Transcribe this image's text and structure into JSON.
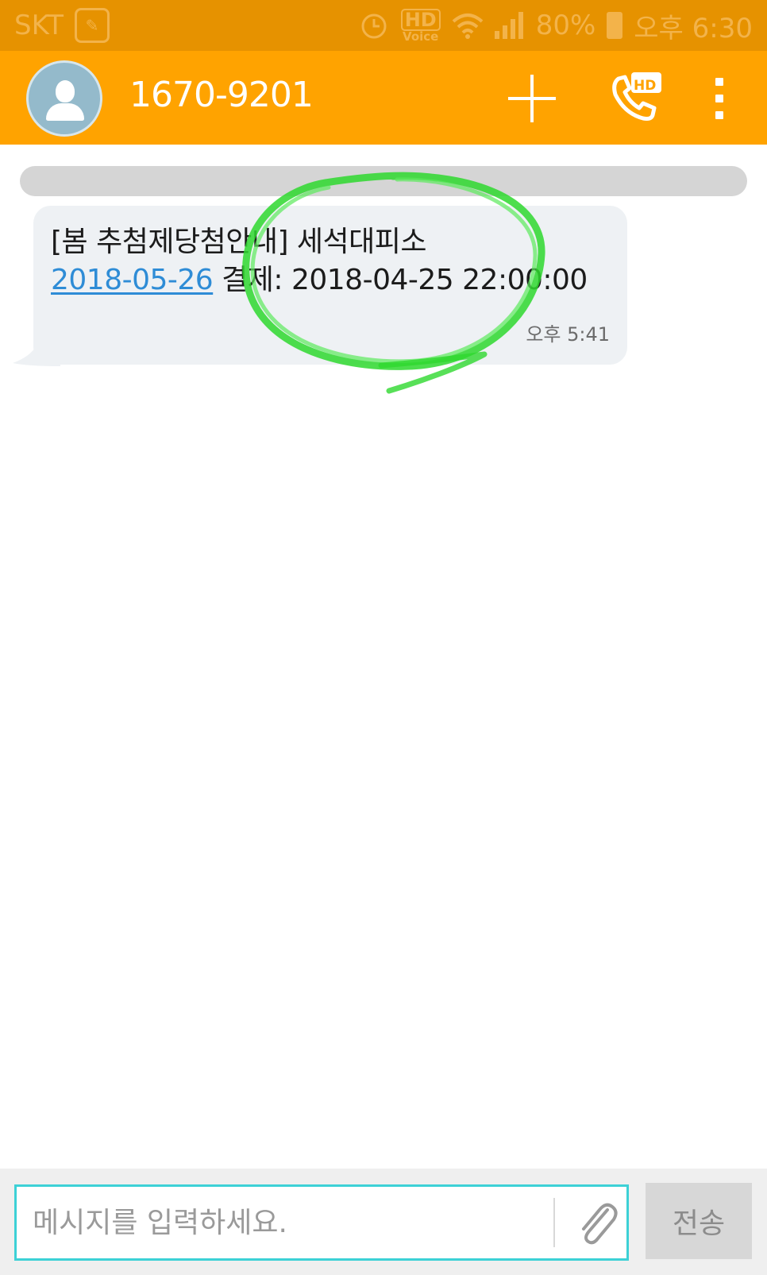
{
  "status_bar": {
    "carrier": "SKT",
    "hd_label": "HD",
    "voice_label": "Voice",
    "battery": "80%",
    "time": "오후 6:30"
  },
  "header": {
    "contact_number": "1670-9201",
    "call_badge": "HD",
    "icons": [
      "contact-avatar-icon",
      "add-icon",
      "hd-call-icon",
      "more-icon"
    ]
  },
  "conversation": {
    "messages": [
      {
        "line1": "[봄 추첨제당첨안내] 세석대피소",
        "link_text": "2018-05-26",
        "line2_rest": " 결제: 2018-04-25 22:00:00",
        "time": "오후 5:41"
      }
    ]
  },
  "composer": {
    "placeholder": "메시지를 입력하세요.",
    "send_label": "전송"
  },
  "colors": {
    "status_bar": "#E69200",
    "header": "#FFA300",
    "bubble": "#EEF1F4",
    "link": "#2E8CD6",
    "input_border": "#3DD1D6",
    "annotation": "#2ED82E"
  }
}
